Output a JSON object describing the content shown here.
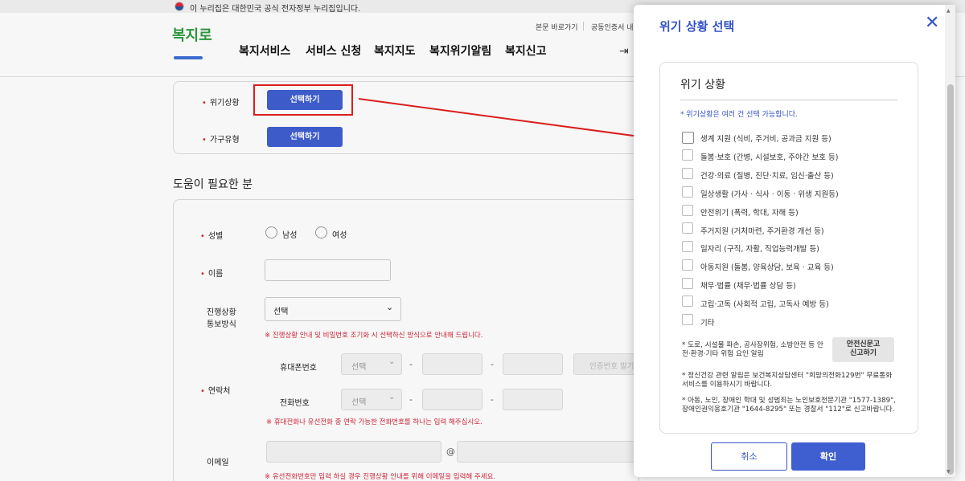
{
  "govbar": {
    "text": "이 누리집은 대한민국 공식 전자정부 누리집입니다."
  },
  "header": {
    "util_links": [
      "본문 바로가기",
      "공동인증서 내"
    ],
    "logo": "복지로",
    "nav": [
      "복지서비스",
      "서비스 신청",
      "복지지도",
      "복지위기알림",
      "복지신고"
    ],
    "login_icon": "login-icon"
  },
  "situation": {
    "crisis_label": "위기상황",
    "crisis_button": "선택하기",
    "household_label": "가구유형",
    "household_button": "선택하기"
  },
  "helpee": {
    "section_title": "도움이 필요한 분",
    "gender_label": "성별",
    "gender_options": [
      "남성",
      "여성"
    ],
    "name_label": "이름",
    "name_value": "",
    "notify_label_1": "진행상황",
    "notify_label_2": "통보방식",
    "notify_select": "선택",
    "notify_warning": "※ 진행상황 안내 및 비밀번호 조기화 시 선택하신 방식으로 안내해 드립니다.",
    "contact_label": "연락처",
    "mobile_label": "휴대폰번호",
    "mobile_select": "선택",
    "phone_label": "전화번호",
    "phone_select": "선택",
    "dash": "-",
    "verify_button": "인증번호 발기",
    "contact_warning": "※ 휴대전화나 유선전화 중 연락 가능한 전화번호를 하나는 입력 해주십시오.",
    "email_label": "이메일",
    "email_at": "@",
    "email_warning": "※ 유선전화번호만 입력 하실 경우 진행상황 안내를 위해 이메일을 입력해 주세요."
  },
  "modal": {
    "title": "위기 상황 선택",
    "close_icon": "close-icon",
    "heading": "위기 상황",
    "note": "* 위기상황은 여러 건 선택 가능합니다.",
    "options": [
      "생계 지원 (식비, 주거비, 공과금 지원 등)",
      "돌봄·보호 (간병, 시설보호, 주야간 보호 등)",
      "건강·의료 (질병, 진단·치료, 임신·출산 등)",
      "일상생활 (가사 · 식사 · 이동 · 위생 지원등)",
      "안전위기 (폭력, 학대, 자해 등)",
      "주거지원 (거처마련, 주거환경 개선 등)",
      "일자리 (구직, 자활, 직업능력개발 등)",
      "아동지원 (돌봄, 양육상담, 보육 · 교육 등)",
      "채무·법률 (채무·법률 상담 등)",
      "고립·고독 (사회적 고립, 고독사 예방 등)",
      "기타"
    ],
    "safety_note": "* 도로, 시설물 파손, 공사장위험, 소방안전 등 안전·환경·기타 위험 요인 알림",
    "safety_button_1": "안전신문고",
    "safety_button_2": "신고하기",
    "mental_note": "* 정신건강 관련 알림은 보건복지상담센터 \"희망의전화129번\" 무료통화 서비스를 이용하시기 바랍니다.",
    "abuse_note": "* 아동, 노인, 장애인 학대 및 성범죄는 노인보호전문기관 \"1577-1389\", 장애인권익옹호기관 \"1644-8295\" 또는 경찰서 \"112\"로 신고바랍니다.",
    "cancel": "취소",
    "confirm": "확인"
  },
  "colors": {
    "primary": "#3f5fd1",
    "required": "#d6263a",
    "annotation": "#e0201e"
  }
}
